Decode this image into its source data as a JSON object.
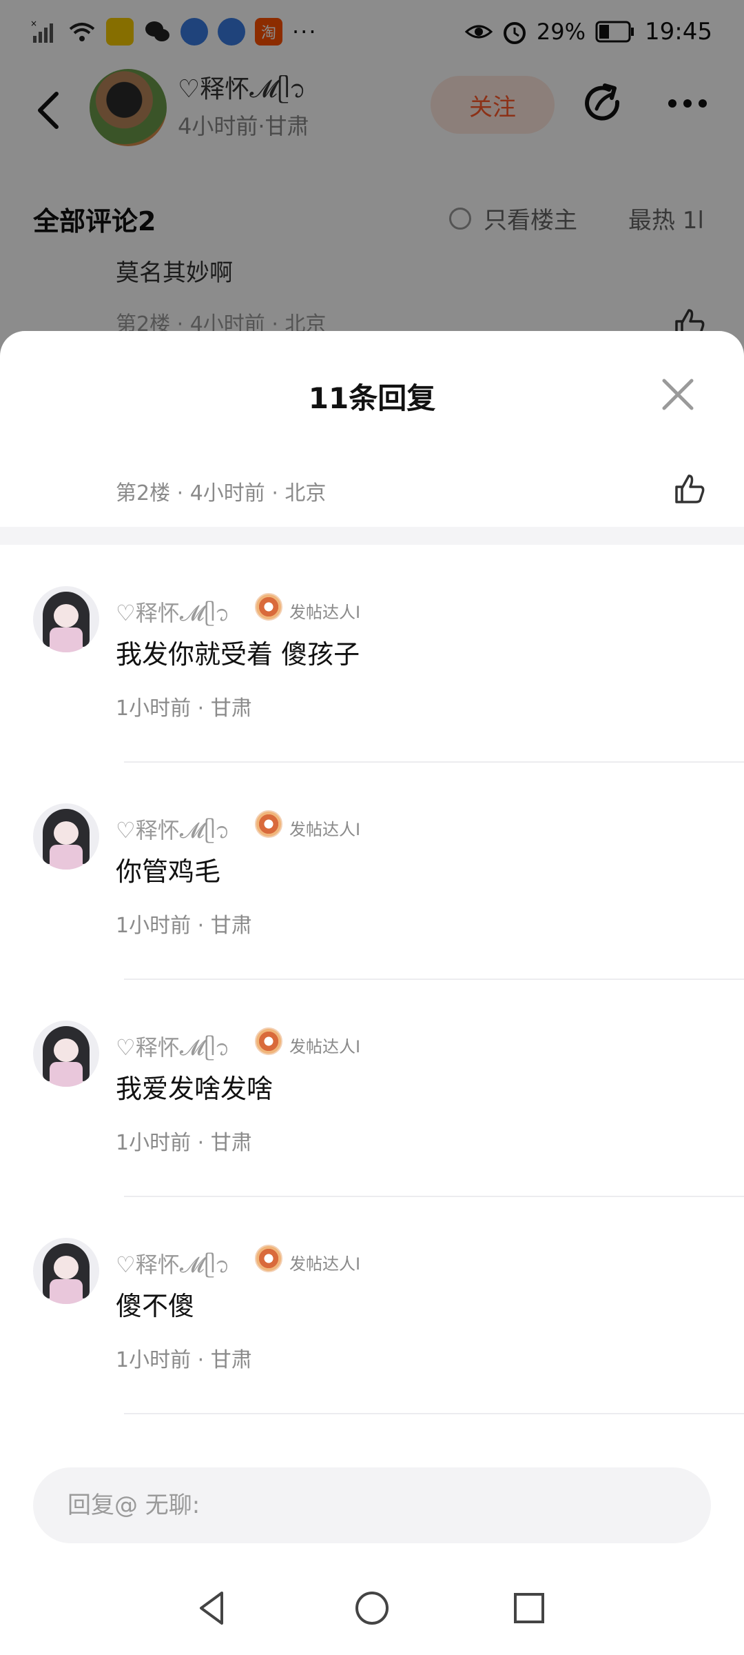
{
  "status_bar": {
    "battery": "29%",
    "time": "19:45",
    "more": "···",
    "left_icons": [
      "signal-icon",
      "wifi-icon",
      "yellow-app-icon",
      "wechat-icon",
      "browser-icon",
      "browser-icon",
      "taobao-icon"
    ],
    "taobao_label": "淘",
    "right_icons": [
      "eye-icon",
      "alarm-icon",
      "battery-icon"
    ]
  },
  "post": {
    "author_name": "♡释怀𝓜ᥫ᭡",
    "author_meta": "4小时前·甘肃",
    "follow_label": "关注"
  },
  "comments_header": {
    "title": "全部评论2",
    "only_op_label": "只看楼主",
    "sort_label": "最热 1l"
  },
  "background_comment": {
    "peek_text": "莫名其妙啊",
    "meta": "第2楼 · 4小时前 · 北京"
  },
  "sheet": {
    "title": "11条回复",
    "parent_meta": "第2楼 · 4小时前 · 北京",
    "replies": [
      {
        "name": "♡释怀𝓜ᥫ᭡",
        "badge": "发帖达人I",
        "text": "我发你就受着 傻孩子",
        "meta": "1小时前 · 甘肃"
      },
      {
        "name": "♡释怀𝓜ᥫ᭡",
        "badge": "发帖达人I",
        "text": "你管鸡毛",
        "meta": "1小时前 · 甘肃"
      },
      {
        "name": "♡释怀𝓜ᥫ᭡",
        "badge": "发帖达人I",
        "text": "我爱发啥发啥",
        "meta": "1小时前 · 甘肃"
      },
      {
        "name": "♡释怀𝓜ᥫ᭡",
        "badge": "发帖达人I",
        "text": "傻不傻",
        "meta": "1小时前 · 甘肃"
      }
    ],
    "reply_placeholder": "回复@ 无聊:"
  },
  "colors": {
    "follow_bg": "#ffe8df",
    "follow_text": "#ff5a2a",
    "overlay": "rgba(0,0,0,0.45)"
  }
}
